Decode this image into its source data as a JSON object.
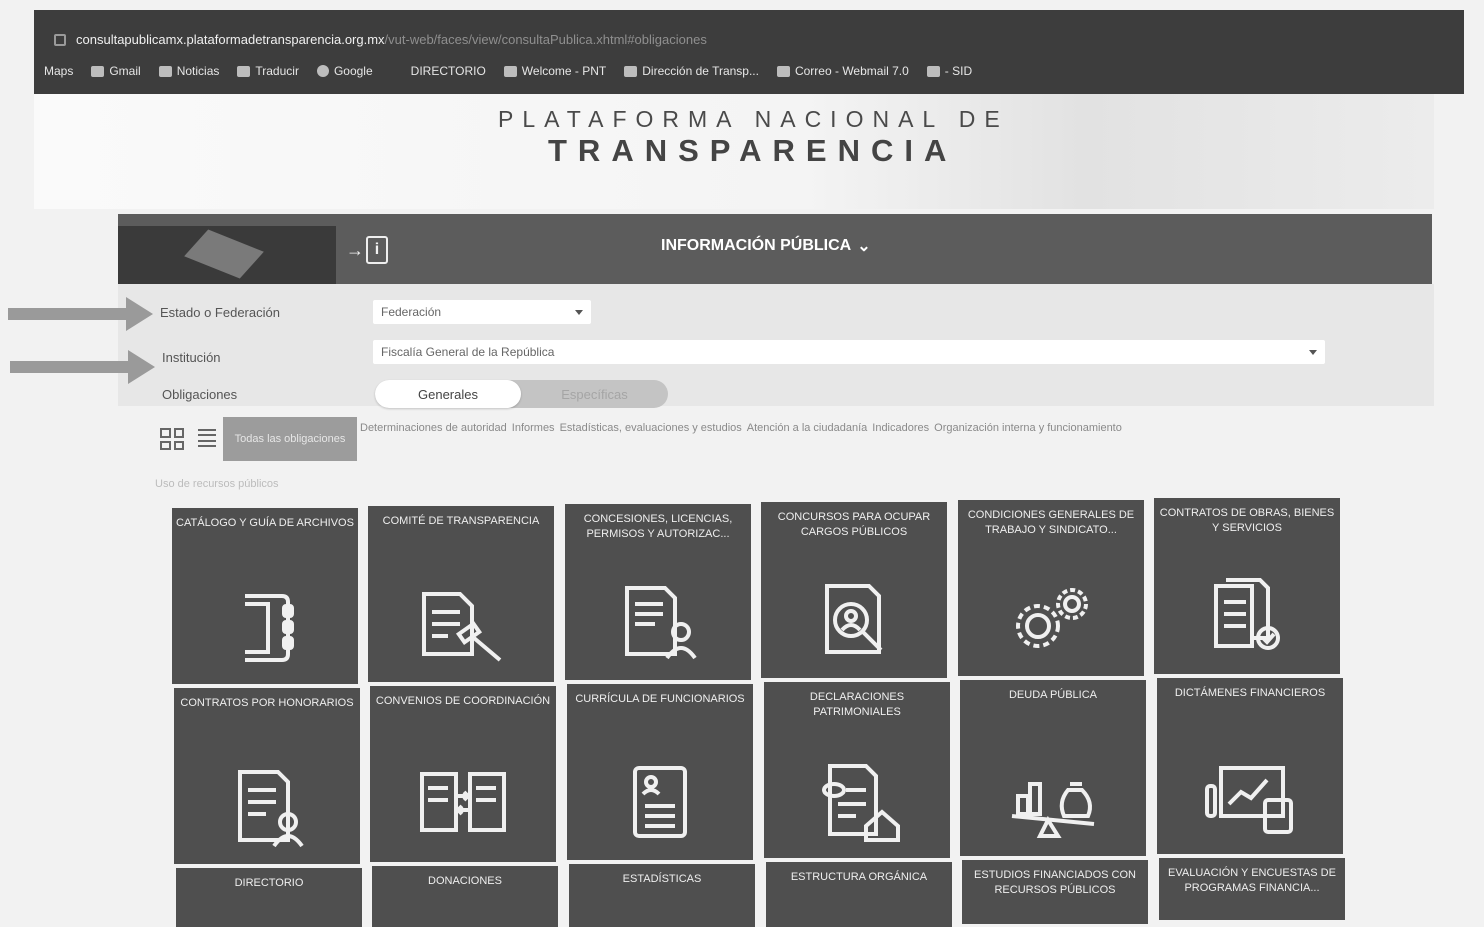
{
  "browser": {
    "url_domain": "consultapublicamx.plataformadetransparencia.org.mx",
    "url_path": "/vut-web/faces/view/consultaPublica.xhtml#obligaciones",
    "bookmarks": [
      "Maps",
      "Gmail",
      "Noticias",
      "Traducir",
      "Google",
      "DIRECTORIO",
      "Welcome - PNT",
      "Dirección de Transp...",
      "Correo - Webmail 7.0",
      "- SID"
    ]
  },
  "header": {
    "title_line1": "PLATAFORMA NACIONAL DE",
    "title_line2": "TRANSPARENCIA"
  },
  "nav": {
    "title": "INFORMACIÓN PÚBLICA",
    "caret": "⌄"
  },
  "filters": {
    "estado_label": "Estado o Federación",
    "estado_value": "Federación",
    "institucion_label": "Institución",
    "institucion_value": "Fiscalía General de la República",
    "obligaciones_label": "Obligaciones",
    "toggle_on": "Generales",
    "toggle_off": "Específicas"
  },
  "tabs": {
    "active": "Todas las obligaciones",
    "others": [
      "Determinaciones de autoridad",
      "Informes",
      "Estadísticas, evaluaciones y estudios",
      "Atención a la ciudadanía",
      "Indicadores",
      "Organización interna y funcionamiento"
    ],
    "extra": "Uso de recursos públicos"
  },
  "tiles": [
    {
      "name": "CATÁLOGO Y GUÍA DE ARCHIVOS",
      "icon": "binder-icon"
    },
    {
      "name": "COMITÉ DE TRANSPARENCIA",
      "icon": "document-gavel-icon"
    },
    {
      "name": "CONCESIONES, LICENCIAS, PERMISOS Y AUTORIZAC...",
      "icon": "document-person-icon"
    },
    {
      "name": "CONCURSOS PARA OCUPAR CARGOS PÚBLICOS",
      "icon": "document-search-person-icon"
    },
    {
      "name": "CONDICIONES GENERALES DE TRABAJO Y SINDICATO...",
      "icon": "gears-icon"
    },
    {
      "name": "CONTRATOS DE OBRAS, BIENES Y SERVICIOS",
      "icon": "documents-check-icon"
    },
    {
      "name": "CONTRATOS POR HONORARIOS",
      "icon": "document-user-icon"
    },
    {
      "name": "CONVENIOS DE COORDINACIÓN",
      "icon": "documents-exchange-icon"
    },
    {
      "name": "CURRÍCULA DE FUNCIONARIOS",
      "icon": "resume-icon"
    },
    {
      "name": "DECLARACIONES PATRIMONIALES",
      "icon": "document-house-icon"
    },
    {
      "name": "DEUDA PÚBLICA",
      "icon": "balance-money-icon"
    },
    {
      "name": "DICTÁMENES FINANCIEROS",
      "icon": "chart-calculator-icon"
    },
    {
      "name": "DIRECTORIO",
      "icon": ""
    },
    {
      "name": "DONACIONES",
      "icon": ""
    },
    {
      "name": "ESTADÍSTICAS",
      "icon": ""
    },
    {
      "name": "ESTRUCTURA ORGÁNICA",
      "icon": ""
    },
    {
      "name": "ESTUDIOS FINANCIADOS CON RECURSOS PÚBLICOS",
      "icon": ""
    },
    {
      "name": "EVALUACIÓN Y ENCUESTAS DE PROGRAMAS FINANCIA...",
      "icon": ""
    }
  ]
}
